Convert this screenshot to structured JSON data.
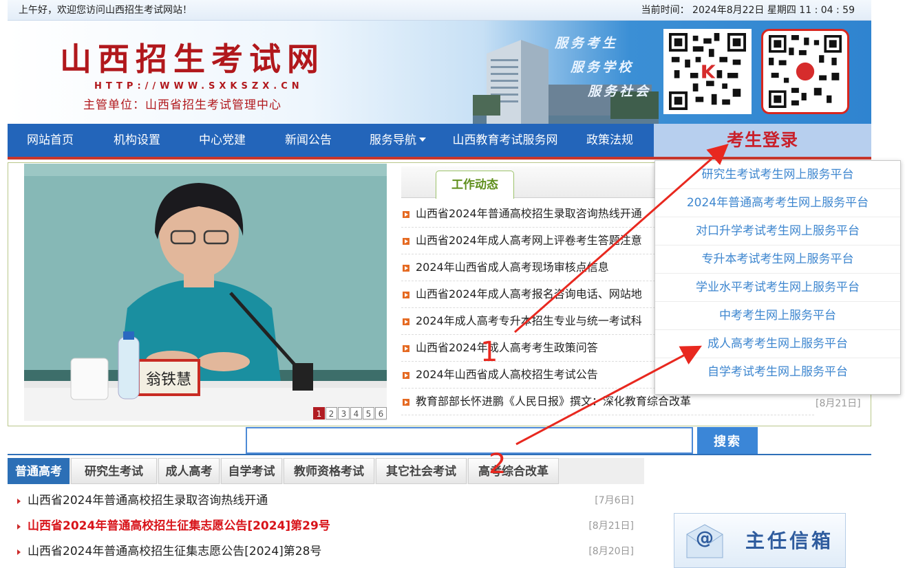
{
  "topbar": {
    "greeting": "上午好，欢迎您访问山西招生考试网站！",
    "time": "当前时间： 2024年8月22日 星期四 11 : 04 : 59"
  },
  "banner": {
    "title": "山西招生考试网",
    "url": "HTTP://WWW.SXKSZX.CN",
    "dept": "主管单位：山西省招生考试管理中心",
    "slogans": [
      "服务考生",
      "服务学校",
      "服务社会"
    ]
  },
  "nav": {
    "items": [
      "网站首页",
      "机构设置",
      "中心党建",
      "新闻公告",
      "服务导航",
      "山西教育考试服务网",
      "政策法规"
    ],
    "login": "考生登录"
  },
  "dropdown": [
    "研究生考试考生网上服务平台",
    "2024年普通高考考生网上服务平台",
    "对口升学考试考生网上服务平台",
    "专升本考试考生网上服务平台",
    "学业水平考试考生网上服务平台",
    "中考考生网上服务平台",
    "成人高考考生网上服务平台",
    "自学考试考生网上服务平台"
  ],
  "slideshow": {
    "pages": [
      "1",
      "2",
      "3",
      "4",
      "5",
      "6"
    ],
    "nameplate": "翁铁慧"
  },
  "work_news": {
    "tab": "工作动态",
    "items": [
      "山西省2024年普通高校招生录取咨询热线开通",
      "山西省2024年成人高考网上评卷考生答题注意",
      "2024年山西省成人高考现场审核点信息",
      "山西省2024年成人高考报名咨询电话、网站地",
      "2024年成人高考专升本招生专业与统一考试科",
      "山西省2024年成人高考考生政策问答",
      "2024年山西省成人高校招生考试公告",
      "教育部部长怀进鹏《人民日报》撰文：深化教育综合改革"
    ],
    "last_date": "[8月21日]"
  },
  "search": {
    "button": "搜索",
    "placeholder": ""
  },
  "tabs": [
    "普通高考",
    "研究生考试",
    "成人高考",
    "自学考试",
    "教师资格考试",
    "其它社会考试",
    "高考综合改革"
  ],
  "gaokao_list": [
    {
      "title": "山西省2024年普通高校招生录取咨询热线开通",
      "date": "[7月6日]"
    },
    {
      "title": "山西省2024年普通高校招生征集志愿公告[2024]第29号",
      "date": "[8月21日]"
    },
    {
      "title": "山西省2024年普通高校招生征集志愿公告[2024]第28号",
      "date": "[8月20日]"
    }
  ],
  "mailbox": {
    "label": "主任信箱"
  },
  "annotations": {
    "label1": "1",
    "label2": "2",
    "color": "#e8281f"
  },
  "colors": {
    "nav": "#2365ba",
    "brand_red": "#b1181c",
    "link_blue": "#3d86cf"
  }
}
